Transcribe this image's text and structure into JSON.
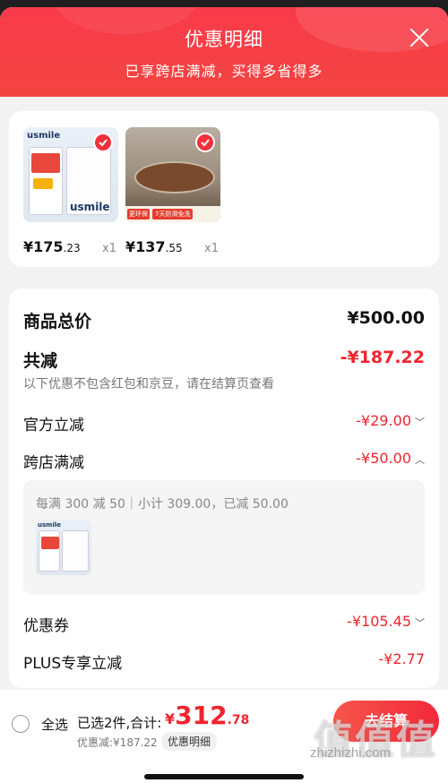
{
  "header": {
    "title": "优惠明细",
    "subtitle": "已享跨店满减，买得多省得多"
  },
  "products": [
    {
      "price_int": "¥175",
      "price_dec": ".23",
      "qty": "x1",
      "brand": "usmile"
    },
    {
      "price_int": "¥137",
      "price_dec": ".55",
      "qty": "x1",
      "badge1": "更环保",
      "badge2": "7天防滑免洗"
    }
  ],
  "detail": {
    "total_label": "商品总价",
    "total_value": "¥500.00",
    "reduce_label": "共减",
    "reduce_value": "-¥187.22",
    "note": "以下优惠不包含红包和京豆，请在结算页查看",
    "official_label": "官方立减",
    "official_value": "-¥29.00",
    "cross_label": "跨店满减",
    "cross_value": "-¥50.00",
    "cross_rule": "每满 300 减 50｜小计 309.00，已减 50.00",
    "coupon_label": "优惠券",
    "coupon_value": "-¥105.45",
    "plus_label": "PLUS专享立减",
    "plus_value": "-¥2.77"
  },
  "footer": {
    "select_all": "全选",
    "selected": "已选2件,合计:",
    "sum_yen": "¥",
    "sum_int": "312",
    "sum_dec": ".78",
    "discount_line": "优惠减:¥187.22",
    "discount_detail": "优惠明细",
    "checkout": "去结算"
  },
  "watermark": {
    "text": "zhizhizhi.com",
    "logo": "值值值"
  },
  "colors": {
    "accent": "#f0242f",
    "header": "#f54145"
  }
}
